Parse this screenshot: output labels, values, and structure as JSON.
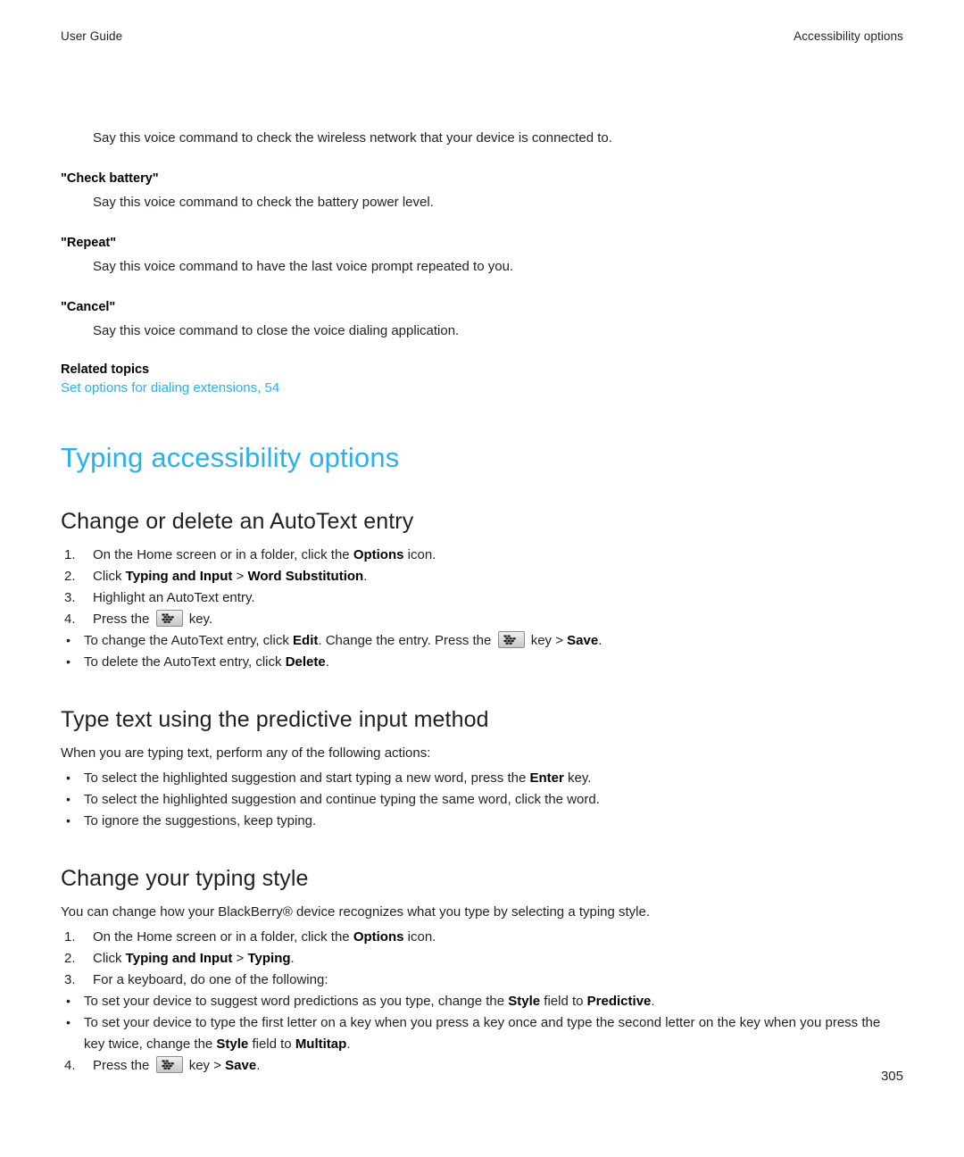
{
  "header": {
    "left": "User Guide",
    "right": "Accessibility options"
  },
  "colors": {
    "link": "#29b0ef",
    "heading": "#29b0ef",
    "text": "#231f20"
  },
  "intro": {
    "lead_paragraph": "Say this voice command to check the wireless network that your device is connected to."
  },
  "voice_commands": [
    {
      "term": "\"Check battery\"",
      "description": "Say this voice command to check the battery power level."
    },
    {
      "term": "\"Repeat\"",
      "description": "Say this voice command to have the last voice prompt repeated to you."
    },
    {
      "term": "\"Cancel\"",
      "description": "Say this voice command to close the voice dialing application."
    }
  ],
  "related": {
    "title": "Related topics",
    "link": "Set options for dialing extensions, 54"
  },
  "chapter": {
    "title": "Typing accessibility options"
  },
  "sections": [
    {
      "heading": "Change or delete an AutoText entry",
      "steps": [
        {
          "num": "1.",
          "parts": [
            {
              "t": "On the Home screen or in a folder, click the ",
              "b": false
            },
            {
              "t": "Options",
              "b": true
            },
            {
              "t": " icon.",
              "b": false
            }
          ]
        },
        {
          "num": "2.",
          "parts": [
            {
              "t": "Click ",
              "b": false
            },
            {
              "t": "Typing and Input",
              "b": true
            },
            {
              "t": " > ",
              "b": false
            },
            {
              "t": "Word Substitution",
              "b": true
            },
            {
              "t": ".",
              "b": false
            }
          ]
        },
        {
          "num": "3.",
          "parts": [
            {
              "t": "Highlight an AutoText entry.",
              "b": false
            }
          ]
        },
        {
          "num": "4.",
          "parts": [
            {
              "t": "Press the ",
              "b": false
            },
            {
              "key": "blackberry-menu-key"
            },
            {
              "t": " key.",
              "b": false
            }
          ]
        }
      ],
      "substeps": [
        {
          "parts": [
            {
              "t": "To change the AutoText entry, click ",
              "b": false
            },
            {
              "t": "Edit",
              "b": true
            },
            {
              "t": ". Change the entry. Press the ",
              "b": false
            },
            {
              "key": "blackberry-menu-key"
            },
            {
              "t": " key > ",
              "b": false
            },
            {
              "t": "Save",
              "b": true
            },
            {
              "t": ".",
              "b": false
            }
          ]
        },
        {
          "parts": [
            {
              "t": "To delete the AutoText entry, click ",
              "b": false
            },
            {
              "t": "Delete",
              "b": true
            },
            {
              "t": ".",
              "b": false
            }
          ]
        }
      ]
    },
    {
      "heading": "Type text using the predictive input method",
      "intro": "When you are typing text, perform any of the following actions:",
      "bullets": [
        {
          "parts": [
            {
              "t": "To select the highlighted suggestion and start typing a new word, press the ",
              "b": false
            },
            {
              "t": "Enter",
              "b": true
            },
            {
              "t": " key.",
              "b": false
            }
          ]
        },
        {
          "parts": [
            {
              "t": "To select the highlighted suggestion and continue typing the same word, click the word.",
              "b": false
            }
          ]
        },
        {
          "parts": [
            {
              "t": "To ignore the suggestions, keep typing.",
              "b": false
            }
          ]
        }
      ]
    },
    {
      "heading": "Change your typing style",
      "intro": "You can change how your BlackBerry® device recognizes what you type by selecting a typing style.",
      "steps": [
        {
          "num": "1.",
          "parts": [
            {
              "t": "On the Home screen or in a folder, click the ",
              "b": false
            },
            {
              "t": "Options",
              "b": true
            },
            {
              "t": " icon.",
              "b": false
            }
          ]
        },
        {
          "num": "2.",
          "parts": [
            {
              "t": "Click ",
              "b": false
            },
            {
              "t": "Typing and Input",
              "b": true
            },
            {
              "t": " > ",
              "b": false
            },
            {
              "t": "Typing",
              "b": true
            },
            {
              "t": ".",
              "b": false
            }
          ]
        },
        {
          "num": "3.",
          "parts": [
            {
              "t": "For a keyboard, do one of the following:",
              "b": false
            }
          ]
        }
      ],
      "substeps": [
        {
          "parts": [
            {
              "t": "To set your device to suggest word predictions as you type, change the ",
              "b": false
            },
            {
              "t": "Style",
              "b": true
            },
            {
              "t": " field to ",
              "b": false
            },
            {
              "t": "Predictive",
              "b": true
            },
            {
              "t": ".",
              "b": false
            }
          ]
        },
        {
          "parts": [
            {
              "t": "To set your device to type the first letter on a key when you press a key once and type the second letter on the key when you press the key twice, change the ",
              "b": false
            },
            {
              "t": "Style",
              "b": true
            },
            {
              "t": " field to ",
              "b": false
            },
            {
              "t": "Multitap",
              "b": true
            },
            {
              "t": ".",
              "b": false
            }
          ]
        }
      ],
      "steps_after": [
        {
          "num": "4.",
          "parts": [
            {
              "t": "Press the ",
              "b": false
            },
            {
              "key": "blackberry-menu-key"
            },
            {
              "t": " key > ",
              "b": false
            },
            {
              "t": "Save",
              "b": true
            },
            {
              "t": ".",
              "b": false
            }
          ]
        }
      ]
    }
  ],
  "footer": {
    "page_number": "305"
  }
}
